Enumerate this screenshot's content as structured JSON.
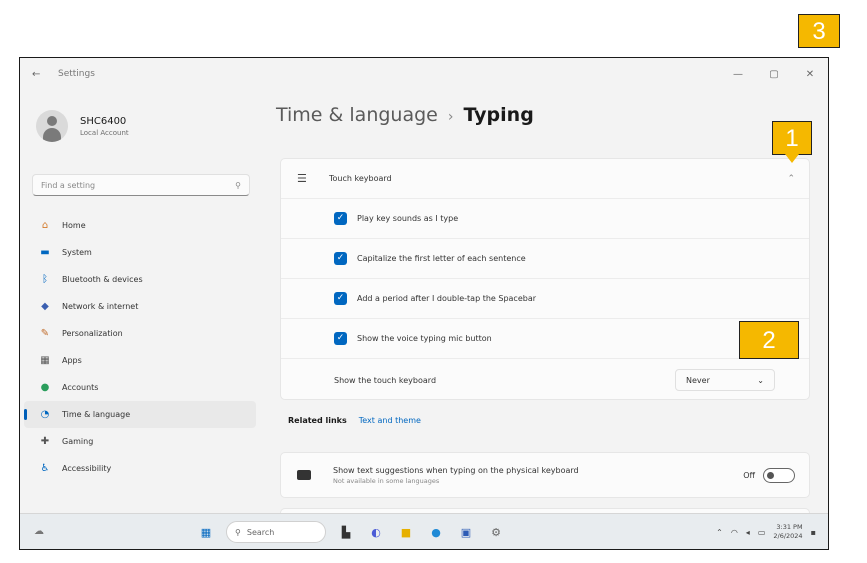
{
  "window": {
    "title": "Settings"
  },
  "window_controls": [
    "—",
    "▢",
    "✕"
  ],
  "user": {
    "name": "SHC6400",
    "account": "Local Account"
  },
  "search": {
    "placeholder": "Find a setting"
  },
  "nav": [
    {
      "label": "Home",
      "icon": "home-icon",
      "glyph": "⌂",
      "color": "#d47a2a"
    },
    {
      "label": "System",
      "icon": "system-icon",
      "glyph": "▬",
      "color": "#0067c0"
    },
    {
      "label": "Bluetooth & devices",
      "icon": "bluetooth-icon",
      "glyph": "ᛒ",
      "color": "#0067c0"
    },
    {
      "label": "Network & internet",
      "icon": "network-icon",
      "glyph": "◆",
      "color": "#3a5fb0"
    },
    {
      "label": "Personalization",
      "icon": "brush-icon",
      "glyph": "✎",
      "color": "#c06a28"
    },
    {
      "label": "Apps",
      "icon": "apps-icon",
      "glyph": "▦",
      "color": "#555555"
    },
    {
      "label": "Accounts",
      "icon": "accounts-icon",
      "glyph": "●",
      "color": "#2a9d5c"
    },
    {
      "label": "Time & language",
      "icon": "globe-clock-icon",
      "glyph": "◔",
      "color": "#0067c0",
      "active": true
    },
    {
      "label": "Gaming",
      "icon": "gaming-icon",
      "glyph": "✚",
      "color": "#555555"
    },
    {
      "label": "Accessibility",
      "icon": "accessibility-icon",
      "glyph": "♿",
      "color": "#0067c0"
    }
  ],
  "breadcrumb": {
    "parent": "Time & language",
    "separator": "›",
    "current": "Typing"
  },
  "touch_keyboard": {
    "title": "Touch keyboard",
    "options": [
      {
        "label": "Play key sounds as I type",
        "checked": true
      },
      {
        "label": "Capitalize the first letter of each sentence",
        "checked": true
      },
      {
        "label": "Add a period after I double-tap the Spacebar",
        "checked": true
      },
      {
        "label": "Show the voice typing mic button",
        "checked": true
      }
    ],
    "show_keyboard": {
      "label": "Show the touch keyboard",
      "value": "Never"
    }
  },
  "related": {
    "label": "Related links",
    "link": "Text and theme"
  },
  "suggestions": {
    "title": "Show text suggestions when typing on the physical keyboard",
    "subtitle": "Not available in some languages",
    "state": "Off"
  },
  "taskbar": {
    "search_placeholder": "Search",
    "time": "3:31 PM",
    "date": "2/6/2024"
  },
  "callouts": {
    "one": "1",
    "two": "2",
    "three": "3"
  }
}
